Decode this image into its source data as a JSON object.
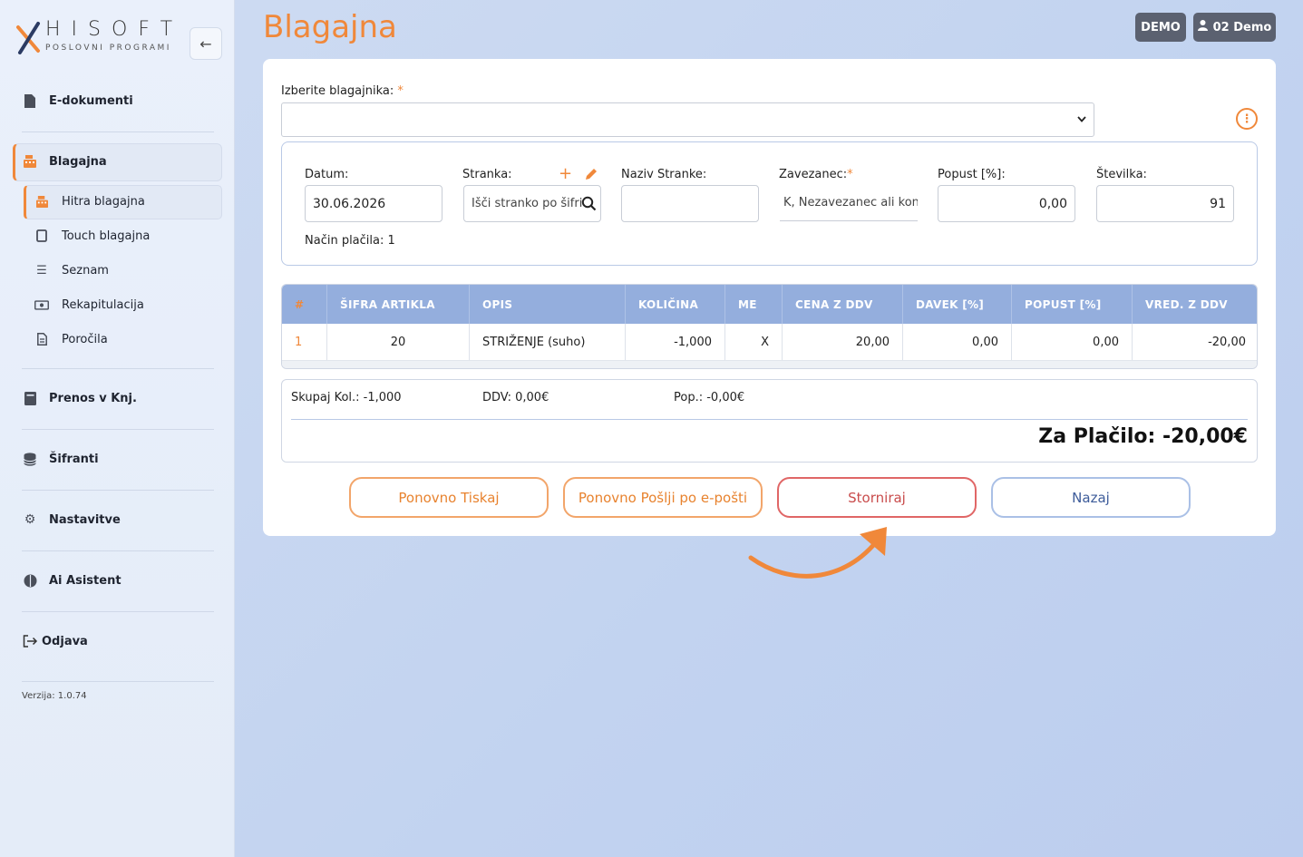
{
  "app": {
    "logo_text": "HISOFT",
    "logo_sub": "POSLOVNI PROGRAMI",
    "version": "Verzija: 1.0.74"
  },
  "sidebar": {
    "items": [
      {
        "label": "E-dokumenti",
        "icon": "file-icon"
      },
      {
        "label": "Blagajna",
        "icon": "cash-register-icon"
      },
      {
        "label": "Prenos v Knj.",
        "icon": "book-icon"
      },
      {
        "label": "Šifranti",
        "icon": "database-icon"
      },
      {
        "label": "Nastavitve",
        "icon": "gear-icon"
      },
      {
        "label": "Ai Asistent",
        "icon": "brain-icon"
      },
      {
        "label": "Odjava",
        "icon": "logout-icon"
      }
    ],
    "sub_items": [
      {
        "label": "Hitra blagajna",
        "icon": "cash-register-icon"
      },
      {
        "label": "Touch blagajna",
        "icon": "tablet-icon"
      },
      {
        "label": "Seznam",
        "icon": "list-icon"
      },
      {
        "label": "Rekapitulacija",
        "icon": "money-icon"
      },
      {
        "label": "Poročila",
        "icon": "report-icon"
      }
    ]
  },
  "header": {
    "title": "Blagajna",
    "badge_demo": "DEMO",
    "badge_user": "02 Demo"
  },
  "form": {
    "cashier_label": "Izberite blagajnika:",
    "cashier_value": "",
    "datum_label": "Datum:",
    "datum_value": "30.06.2026",
    "stranka_label": "Stranka:",
    "stranka_placeholder": "Išči stranko po šifri",
    "naziv_label": "Naziv Stranke:",
    "naziv_value": "",
    "zavezanec_label": "Zavezanec:",
    "zavezanec_value": "K, Nezavezanec ali konč",
    "popust_label": "Popust [%]:",
    "popust_value": "0,00",
    "stevilka_label": "Številka:",
    "stevilka_value": "91",
    "nacin_label": "Način plačila: 1"
  },
  "table": {
    "headers": [
      "#",
      "ŠIFRA ARTIKLA",
      "OPIS",
      "KOLIČINA",
      "ME",
      "CENA Z DDV",
      "DAVEK [%]",
      "POPUST [%]",
      "VRED. Z DDV"
    ],
    "rows": [
      [
        "1",
        "20",
        "STRIŽENJE (suho)",
        "-1,000",
        "X",
        "20,00",
        "0,00",
        "0,00",
        "-20,00"
      ]
    ]
  },
  "summary": {
    "kol": "Skupaj Kol.: -1,000",
    "ddv": "DDV: 0,00€",
    "pop": "Pop.: -0,00€",
    "total": "Za Plačilo: -20,00€"
  },
  "buttons": {
    "reprint": "Ponovno Tiskaj",
    "resend": "Ponovno Pošlji po e-pošti",
    "storno": "Storniraj",
    "back": "Nazaj"
  },
  "colors": {
    "accent": "#f0883a",
    "header_blue": "#94aedd",
    "danger": "#e06666"
  }
}
